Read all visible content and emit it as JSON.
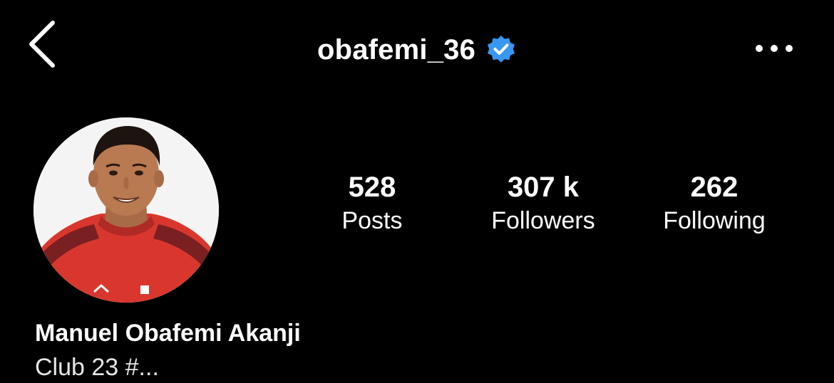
{
  "header": {
    "username": "obafemi_36",
    "verified": true,
    "back_icon": "chevron-left-icon",
    "more_icon": "ellipsis-horizontal-icon",
    "verified_color": "#3897f0"
  },
  "profile": {
    "full_name": "Manuel Obafemi Akanji",
    "bio_partial": "Club 23 #..."
  },
  "stats": [
    {
      "value": "528",
      "label": "Posts"
    },
    {
      "value": "307 k",
      "label": "Followers"
    },
    {
      "value": "262",
      "label": "Following"
    }
  ],
  "colors": {
    "background": "#000000",
    "text": "#ffffff",
    "accent": "#3897f0",
    "jersey_red": "#d9372e"
  }
}
